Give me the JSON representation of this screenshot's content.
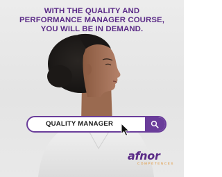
{
  "headline": {
    "line1": "WITH THE QUALITY AND",
    "line2": "PERFORMANCE MANAGER COURSE,",
    "line3": "YOU WILL BE IN DEMAND."
  },
  "search": {
    "value": "QUALITY MANAGER",
    "button_icon": "search-icon"
  },
  "logo": {
    "name": "afnor",
    "tagline": "COMPÉTENCES"
  },
  "colors": {
    "brand_purple": "#5b2b87",
    "search_purple": "#6a3d9a",
    "logo_orange": "#e0912d"
  }
}
